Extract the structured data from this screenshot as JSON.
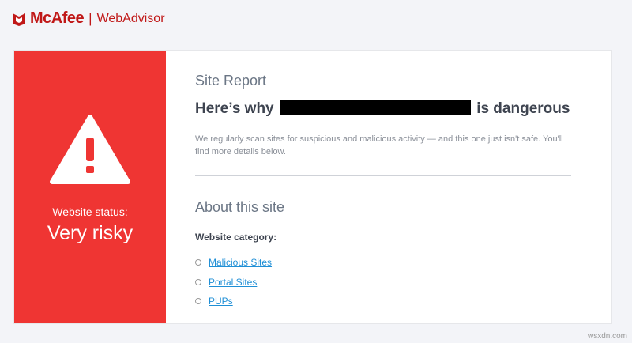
{
  "header": {
    "brand": "McAfee",
    "product": "WebAdvisor"
  },
  "status": {
    "label": "Website status:",
    "value": "Very risky"
  },
  "report": {
    "section_title": "Site Report",
    "heading_prefix": "Here’s why",
    "heading_suffix": "is dangerous",
    "description": "We regularly scan sites for suspicious and malicious activity — and this one just isn't safe. You'll find more details below."
  },
  "about": {
    "title": "About this site",
    "category_label": "Website category:",
    "categories": [
      "Malicious Sites",
      "Portal Sites",
      "PUPs"
    ]
  },
  "watermark": "wsxdn.com",
  "colors": {
    "danger": "#ef3533",
    "brand": "#c01818",
    "link": "#1f8fd6"
  }
}
